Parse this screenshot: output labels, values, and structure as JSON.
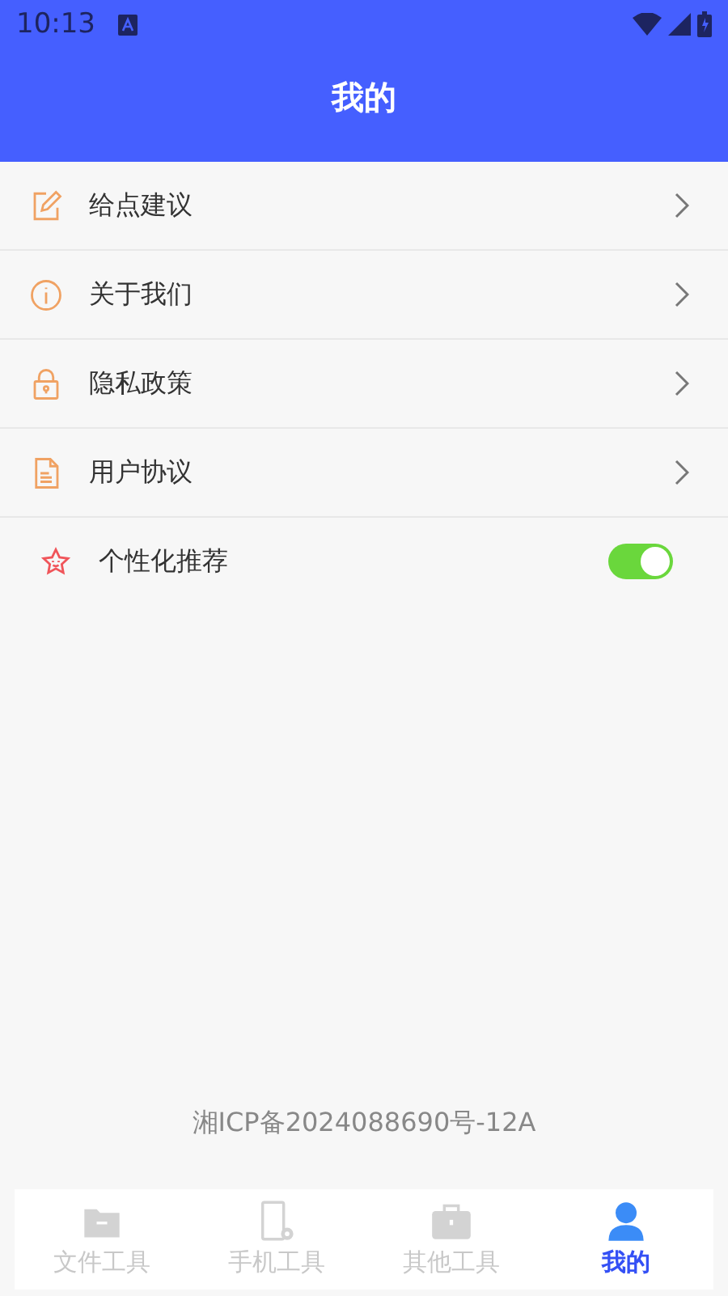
{
  "status_bar": {
    "time": "10:13"
  },
  "header": {
    "title": "我的"
  },
  "menu": [
    {
      "kind": "link",
      "label": "给点建议"
    },
    {
      "kind": "link",
      "label": "关于我们"
    },
    {
      "kind": "link",
      "label": "隐私政策"
    },
    {
      "kind": "link",
      "label": "用户协议"
    },
    {
      "kind": "toggle",
      "label": "个性化推荐",
      "on": true
    }
  ],
  "footer": {
    "icp": "湘ICP备2024088690号-12A"
  },
  "tabs": [
    {
      "label": "文件工具",
      "selected": false
    },
    {
      "label": "手机工具",
      "selected": false
    },
    {
      "label": "其他工具",
      "selected": false
    },
    {
      "label": "我的",
      "selected": true
    }
  ]
}
